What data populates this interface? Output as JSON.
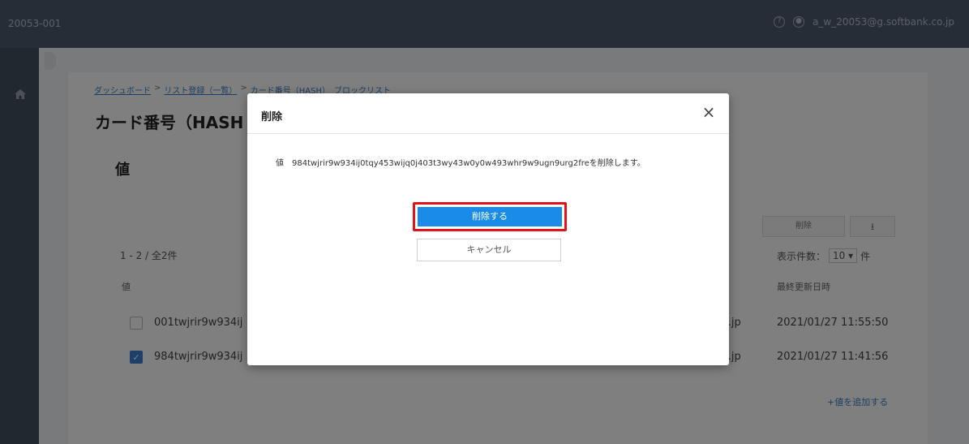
{
  "header": {
    "tenant": "20053-001",
    "user": "a_w_20053@g.softbank.co.jp",
    "help_icon": "question-circle-icon",
    "user_icon": "user-circle-icon"
  },
  "sidebar": {
    "home_icon": "home-icon"
  },
  "breadcrumb": {
    "items": [
      "ダッシュボード",
      "リスト登録（一覧）",
      "カード番号（HASH）　ブロックリスト"
    ],
    "separator": ">"
  },
  "page": {
    "title": "カード番号（HASH",
    "section_label": "値",
    "delete_button": "削除",
    "download_icon": "download-icon",
    "count_text": "1 - 2 / 全2件",
    "per_page_label": "表示件数：",
    "per_page_value": "10",
    "per_page_unit": "件",
    "columns": {
      "value": "値",
      "updated": "最終更新日時"
    },
    "rows": [
      {
        "value": "001twjrir9w934ij",
        "mail_suffix": "o.jp",
        "updated": "2021/01/27 11:55:50",
        "checked": false
      },
      {
        "value": "984twjrir9w934ij",
        "mail_suffix": "o.jp",
        "updated": "2021/01/27 11:41:56",
        "checked": true
      }
    ],
    "add_link": "+値を追加する"
  },
  "modal": {
    "title": "削除",
    "close_icon": "close-icon",
    "message_label": "値",
    "message": "984twjrir9w934ij0tqy453wijq0j403t3wy43w0y0w493whr9w9ugn9urg2freを削除します。",
    "confirm_label": "削除する",
    "cancel_label": "キャンセル"
  },
  "colors": {
    "topbar": "#4f5a6e",
    "sidebar": "#44505f",
    "primary": "#1a8be8",
    "highlight_border": "#e0131b"
  }
}
